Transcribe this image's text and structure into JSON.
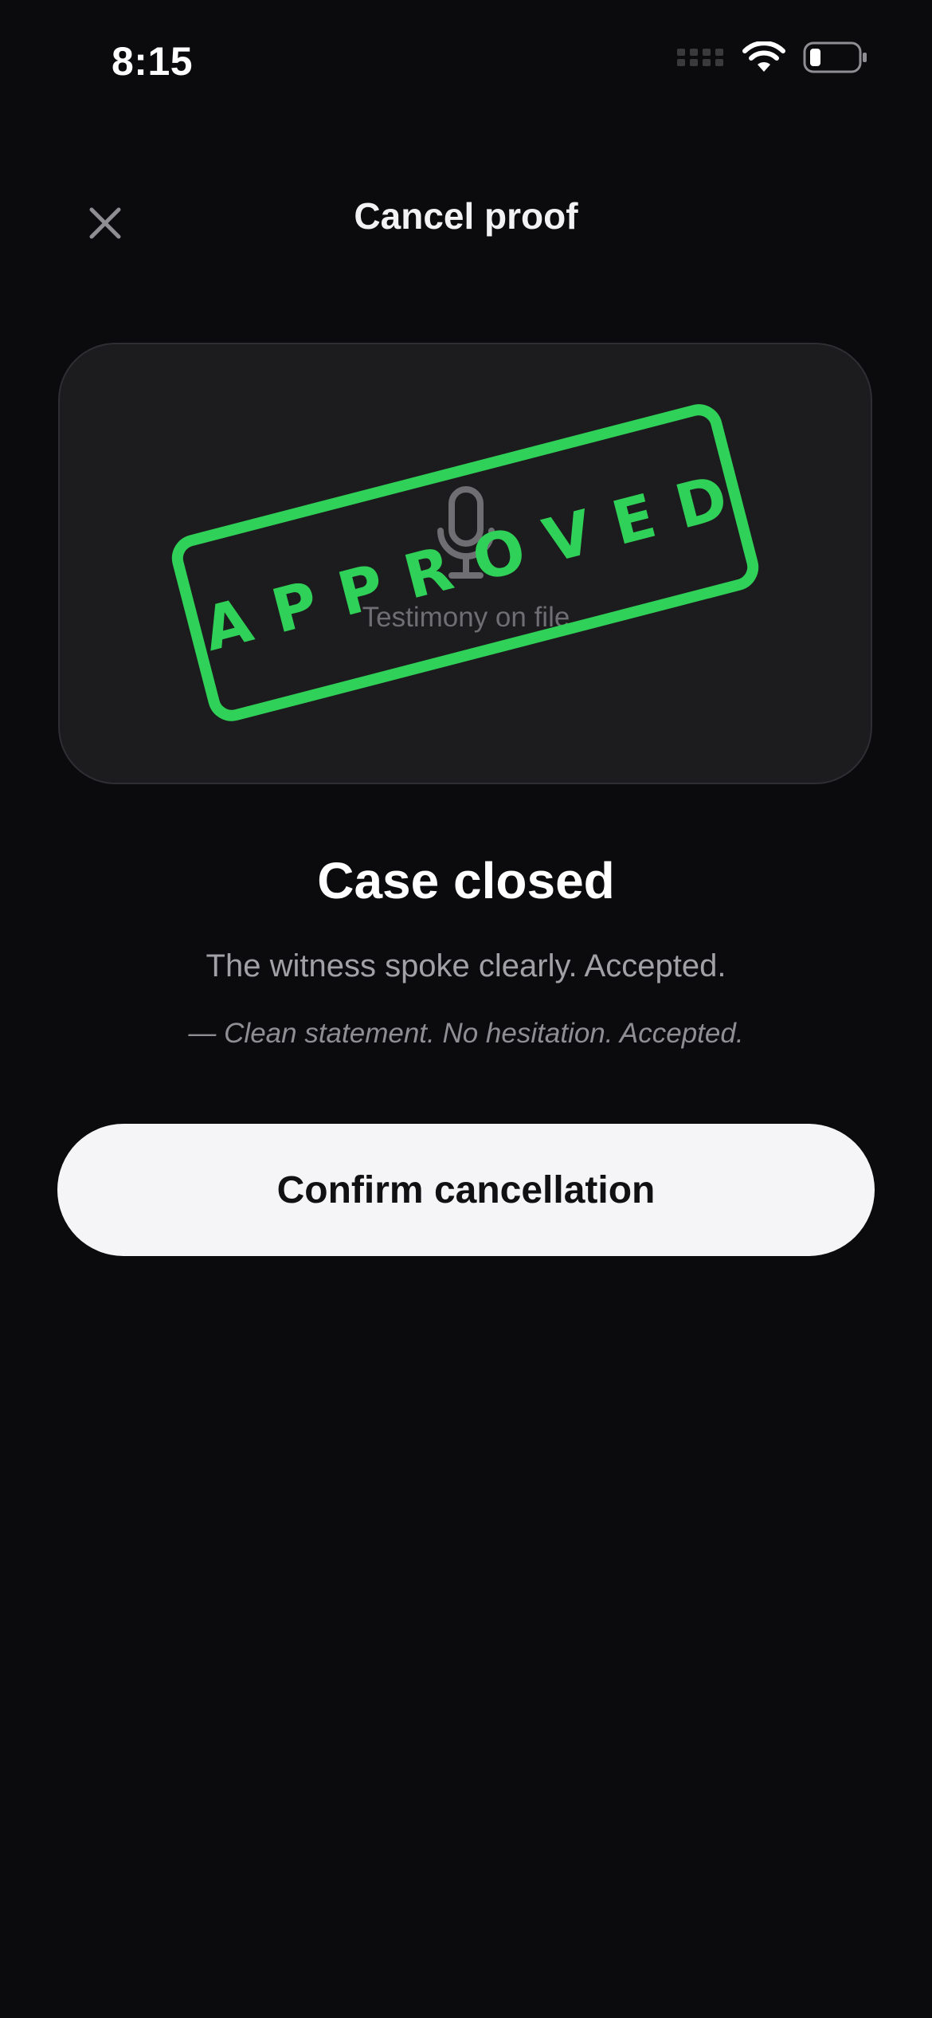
{
  "status_bar": {
    "time": "8:15",
    "icons": [
      "cellular-signal-icon",
      "wifi-icon",
      "battery-icon"
    ]
  },
  "header": {
    "close_icon": "close-icon",
    "title": "Cancel proof"
  },
  "proof_card": {
    "media_icon": "microphone-icon",
    "label": "Testimony on file",
    "stamp_text": "APPROVED",
    "stamp_color": "#30d158"
  },
  "result": {
    "title": "Case closed",
    "message": "The witness spoke clearly. Accepted.",
    "quote": "— Clean statement. No hesitation. Accepted."
  },
  "actions": {
    "confirm_label": "Confirm cancellation"
  },
  "colors": {
    "background": "#0b0b0d",
    "card": "#1c1c1e",
    "accent": "#30d158",
    "button": "#f5f5f7"
  }
}
